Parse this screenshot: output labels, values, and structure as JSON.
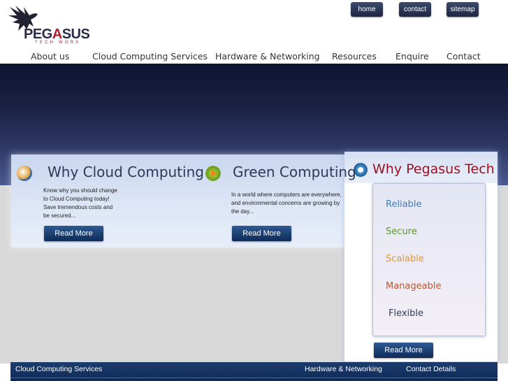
{
  "logo": {
    "word_start": "PEG",
    "word_accent": "A",
    "word_end": "SUS",
    "sub": "TECH WORX"
  },
  "top_buttons": {
    "home": "home",
    "contact": "contact",
    "sitemap": "sitemap"
  },
  "nav": [
    "About us",
    "Cloud Computing Services",
    "Hardware & Networking",
    "Resources",
    "Enquire",
    "Contact"
  ],
  "features": [
    {
      "title": "Why Cloud Computing",
      "text": "Know why you should change\nto Cloud Computing today!\nSave tremendous costs and\nbe secured...",
      "button": "Read More",
      "icon": "cloud-badge-icon"
    },
    {
      "title": "Green Computing",
      "text": "In a world where computers are everywhere,\nand environmental concerns are growing by\nthe day...",
      "button": "Read More",
      "icon": "green-play-icon"
    }
  ],
  "why": {
    "title": "Why Pegasus Tech",
    "icon": "globe-icon",
    "items": [
      "Reliable",
      "Secure",
      "Scalable",
      "Manageable",
      "Flexible"
    ],
    "button": "Read More"
  },
  "footer": {
    "links": [
      "Cloud Computing Services",
      "Hardware & Networking",
      "Contact Details"
    ]
  },
  "colors": {
    "banner_dark": "#0e1530",
    "accent_red": "#9b1224",
    "button_blue": "#0e2a57"
  }
}
